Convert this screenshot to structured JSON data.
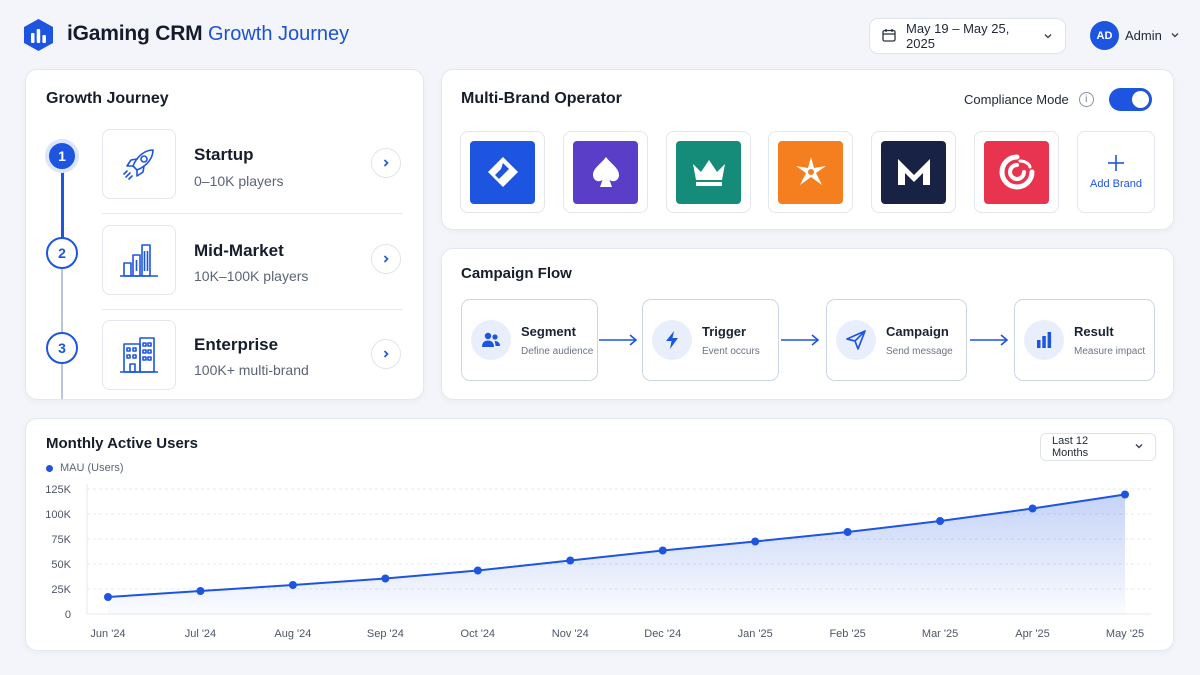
{
  "header": {
    "app_title": "iGaming CRM",
    "section_title": "Growth Journey",
    "date_range": "May 19 – May 25, 2025",
    "user_initials": "AD",
    "user_name": "Admin"
  },
  "growth_journey": {
    "title": "Growth Journey",
    "stages": [
      {
        "number": "1",
        "name": "Startup",
        "desc": "0–10K players",
        "icon": "rocket-icon",
        "active": true
      },
      {
        "number": "2",
        "name": "Mid-Market",
        "desc": "10K–100K players",
        "icon": "bar-building-icon",
        "active": false
      },
      {
        "number": "3",
        "name": "Enterprise",
        "desc": "100K+ multi-brand",
        "icon": "office-building-icon",
        "active": false
      }
    ]
  },
  "multi_brand": {
    "title": "Multi-Brand Operator",
    "compliance_label": "Compliance Mode",
    "compliance_on": true,
    "brands": [
      {
        "icon": "diamond-logo-icon",
        "color": "#1d55e0"
      },
      {
        "icon": "spade-logo-icon",
        "color": "#5a3ec8"
      },
      {
        "icon": "crown-logo-icon",
        "color": "#158c79"
      },
      {
        "icon": "star-logo-icon",
        "color": "#f57f1f"
      },
      {
        "icon": "m-logo-icon",
        "color": "#172244"
      },
      {
        "icon": "swirl-logo-icon",
        "color": "#e8344f"
      }
    ],
    "add_brand_label": "Add Brand"
  },
  "campaign_flow": {
    "title": "Campaign Flow",
    "steps": [
      {
        "title": "Segment",
        "sub": "Define audience",
        "icon": "users-icon"
      },
      {
        "title": "Trigger",
        "sub": "Event occurs",
        "icon": "lightning-icon"
      },
      {
        "title": "Campaign",
        "sub": "Send message",
        "icon": "send-icon"
      },
      {
        "title": "Result",
        "sub": "Measure impact",
        "icon": "bar-chart-icon"
      }
    ]
  },
  "mau_card": {
    "title": "Monthly Active Users",
    "range_label": "Last 12 Months"
  },
  "chart_data": {
    "type": "area",
    "title": "Monthly Active Users",
    "categories": [
      "Jun '24",
      "Jul '24",
      "Aug '24",
      "Sep '24",
      "Oct '24",
      "Nov '24",
      "Dec '24",
      "Jan '25",
      "Feb '25",
      "Mar '25",
      "Apr '25",
      "May '25"
    ],
    "series": [
      {
        "name": "MAU (Users)",
        "values": [
          17000,
          23000,
          29000,
          35500,
          43500,
          53500,
          63500,
          72500,
          82000,
          93000,
          105500,
          119500
        ]
      }
    ],
    "ylim": [
      0,
      125000
    ],
    "yticks": [
      0,
      25000,
      50000,
      75000,
      100000,
      125000
    ],
    "ytick_labels": [
      "0",
      "25K",
      "50K",
      "75K",
      "100K",
      "125K"
    ],
    "grid": true,
    "legend": "top-left",
    "color": "#1d55e0"
  }
}
